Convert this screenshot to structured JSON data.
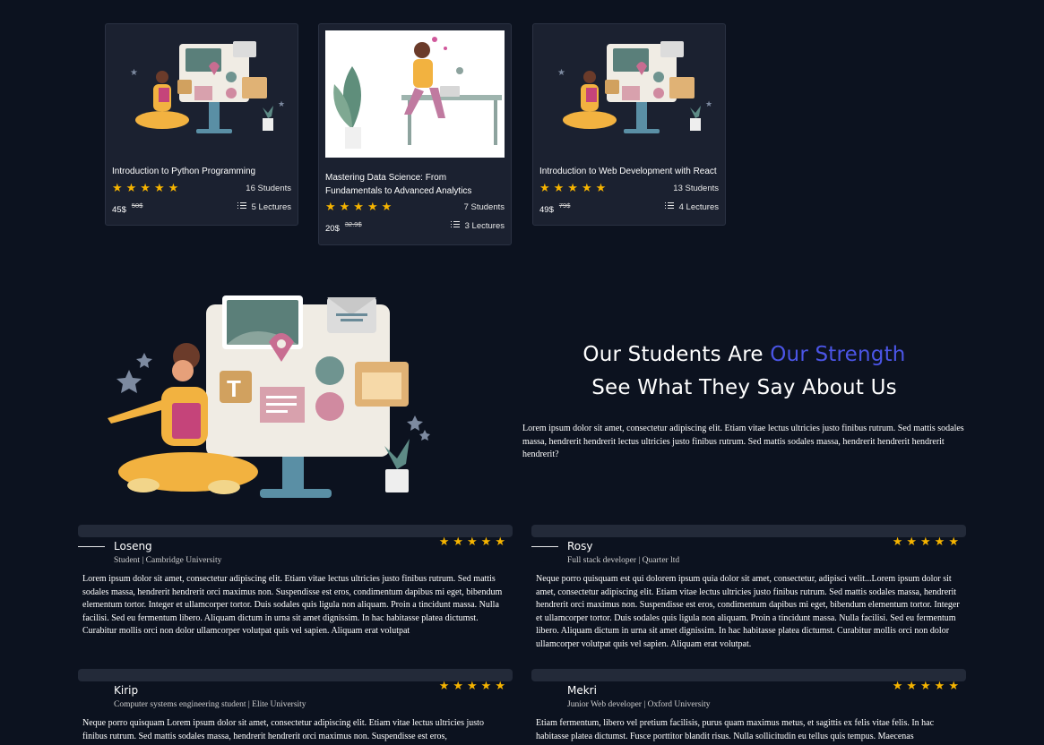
{
  "courses": [
    {
      "title": "Introduction to Python Programming",
      "rating": "★★★★★",
      "students": "16 Students",
      "price": "45$",
      "old_price": "50$",
      "lectures": "5 Lectures"
    },
    {
      "title": "Mastering Data Science: From Fundamentals to Advanced Analytics",
      "rating": "★★★★★",
      "students": "7 Students",
      "price": "20$",
      "old_price": "32.9$",
      "lectures": "3 Lectures"
    },
    {
      "title": "Introduction to Web Development with React",
      "rating": "★★★★★",
      "students": "13 Students",
      "price": "49$",
      "old_price": "79$",
      "lectures": "4 Lectures"
    }
  ],
  "testimonials_section": {
    "heading_part1": "Our Students Are ",
    "heading_accent": "Our Strength",
    "heading_line2": "See What They Say About Us",
    "intro": "Lorem ipsum dolor sit amet, consectetur adipiscing elit. Etiam vitae lectus ultricies justo finibus rutrum. Sed mattis sodales massa, hendrerit hendrerit lectus ultricies justo finibus rutrum. Sed mattis sodales massa, hendrerit hendrerit hendrerit hendrerit?"
  },
  "reviews": [
    {
      "name": "Loseng",
      "role": "Student | Cambridge University",
      "rating": "★★★★★",
      "text": "Lorem ipsum dolor sit amet, consectetur adipiscing elit. Etiam vitae lectus ultricies justo finibus rutrum. Sed mattis sodales massa, hendrerit hendrerit orci maximus non. Suspendisse est eros, condimentum dapibus mi eget, bibendum elementum tortor. Integer et ullamcorper tortor. Duis sodales quis ligula non aliquam. Proin a tincidunt massa. Nulla facilisi. Sed eu fermentum libero. Aliquam dictum in urna sit amet dignissim. In hac habitasse platea dictumst. Curabitur mollis orci non dolor ullamcorper volutpat quis vel sapien. Aliquam erat volutpat"
    },
    {
      "name": "Rosy",
      "role": "Full stack developer | Quarter ltd",
      "rating": "★★★★★",
      "text": "Neque porro quisquam est qui dolorem ipsum quia dolor sit amet, consectetur, adipisci velit...Lorem ipsum dolor sit amet, consectetur adipiscing elit. Etiam vitae lectus ultricies justo finibus rutrum. Sed mattis sodales massa, hendrerit hendrerit orci maximus non. Suspendisse est eros, condimentum dapibus mi eget, bibendum elementum tortor. Integer et ullamcorper tortor. Duis sodales quis ligula non aliquam. Proin a tincidunt massa. Nulla facilisi. Sed eu fermentum libero. Aliquam dictum in urna sit amet dignissim. In hac habitasse platea dictumst. Curabitur mollis orci non dolor ullamcorper volutpat quis vel sapien. Aliquam erat volutpat."
    },
    {
      "name": "Kirip",
      "role": "Computer systems engineering student | Elite University",
      "rating": "★★★★★",
      "text": "Neque porro quisquam Lorem ipsum dolor sit amet, consectetur adipiscing elit. Etiam vitae lectus ultricies justo finibus rutrum. Sed mattis sodales massa, hendrerit hendrerit orci maximus non. Suspendisse est eros,"
    },
    {
      "name": "Mekri",
      "role": "Junior Web developer | Oxford University",
      "rating": "★★★★★",
      "text": "Etiam fermentum, libero vel pretium facilisis, purus quam maximus metus, et sagittis ex felis vitae felis. In hac habitasse platea dictumst. Fusce porttitor blandit risus. Nulla sollicitudin eu tellus quis tempus. Maecenas"
    }
  ],
  "colors": {
    "background": "#0c121f",
    "card": "#1b2130",
    "star": "#f6b400",
    "accent": "#4b55e6"
  },
  "icons": {
    "list": "list-icon",
    "star": "star-icon"
  }
}
